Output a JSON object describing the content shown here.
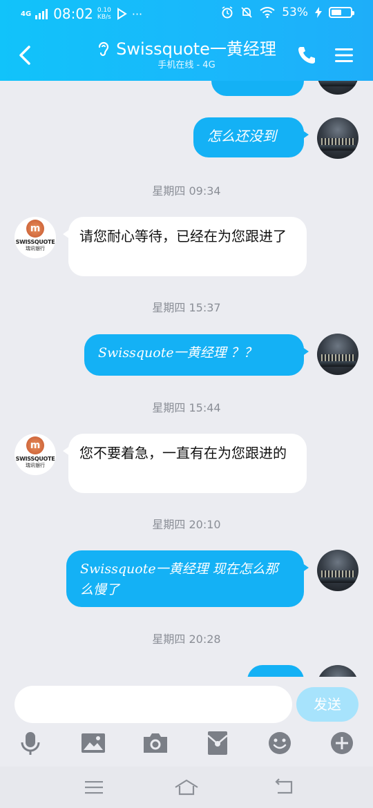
{
  "status_bar": {
    "network": "4G",
    "time": "08:02",
    "speed_value": "0.10",
    "speed_unit": "KB/s",
    "more": "···",
    "battery_percent": "53%",
    "battery_level": 0.53
  },
  "header": {
    "title": "Swissquote一黄经理",
    "subtitle": "手机在线 - 4G"
  },
  "avatar_bank": {
    "brand": "SWISSQUOTE",
    "brand_cn": "瑞讯银行",
    "logo_glyph": "m"
  },
  "messages": [
    {
      "type": "out",
      "text": "怎么还没到"
    },
    {
      "type": "time",
      "text": "星期四 09:34"
    },
    {
      "type": "in",
      "text": "请您耐心等待，已经在为您跟进了"
    },
    {
      "type": "time",
      "text": "星期四 15:37"
    },
    {
      "type": "out",
      "text": "Swissquote一黄经理 ？？"
    },
    {
      "type": "time",
      "text": "星期四 15:44"
    },
    {
      "type": "in",
      "text": "您不要着急，一直有在为您跟进的"
    },
    {
      "type": "time",
      "text": "星期四 20:10"
    },
    {
      "type": "out",
      "text": "Swissquote一黄经理 现在怎么那么慢了"
    },
    {
      "type": "time",
      "text": "星期四 20:28"
    }
  ],
  "input": {
    "value": "",
    "send_label": "发送"
  },
  "toolbar_icons": [
    "microphone-icon",
    "image-icon",
    "camera-icon",
    "red-packet-icon",
    "emoji-icon",
    "plus-icon"
  ],
  "navbar_icons": [
    "menu-icon",
    "home-icon",
    "back-icon"
  ],
  "colors": {
    "header": "#19b8fb",
    "bubble_out": "#14b1f5",
    "bubble_in": "#ffffff",
    "background": "#ebecf1",
    "send_button": "#a7e3fc"
  }
}
